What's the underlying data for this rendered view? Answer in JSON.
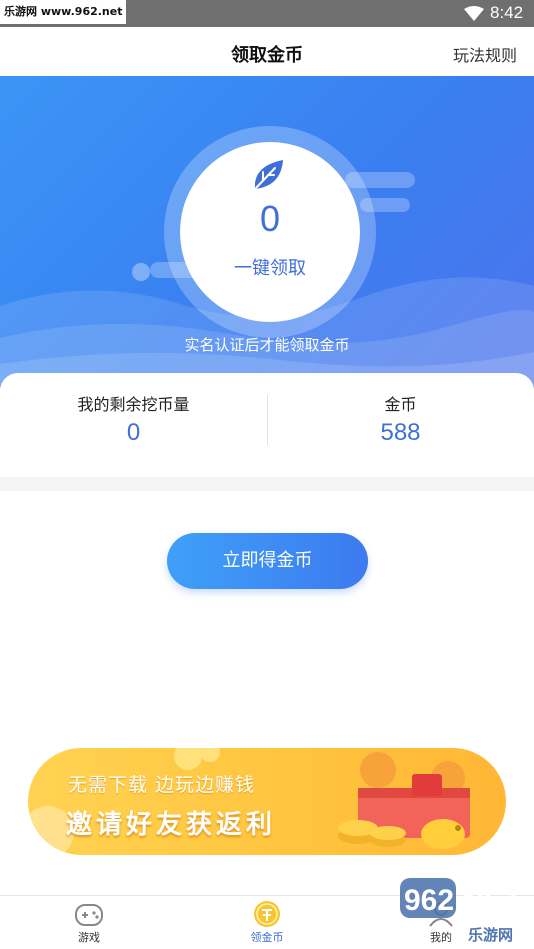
{
  "status_bar": {
    "site_label": "乐游网 www.962.net",
    "time": "8:42"
  },
  "header": {
    "title": "领取金币",
    "rules_link": "玩法规则"
  },
  "hero": {
    "claim_count": "0",
    "claim_label": "一键领取",
    "notice": "实名认证后才能领取金币"
  },
  "stats": {
    "remaining_label": "我的剩余挖币量",
    "remaining_value": "0",
    "coins_label": "金币",
    "coins_value": "588"
  },
  "actions": {
    "get_coins_label": "立即得金币"
  },
  "banner": {
    "subtitle": "无需下载 边玩边赚钱",
    "title": "邀请好友获返利"
  },
  "tabs": [
    {
      "label": "游戏",
      "icon": "gamepad-icon",
      "active": false
    },
    {
      "label": "领金币",
      "icon": "coin-icon",
      "active": true
    },
    {
      "label": "我的",
      "icon": "user-icon",
      "active": false
    }
  ],
  "watermark": {
    "text": "962.NET",
    "subtext": "乐游网"
  },
  "colors": {
    "primary": "#3c7af0",
    "accent_text": "#3f6fd8",
    "banner": "#ffc43e",
    "coin": "#f7c531"
  }
}
